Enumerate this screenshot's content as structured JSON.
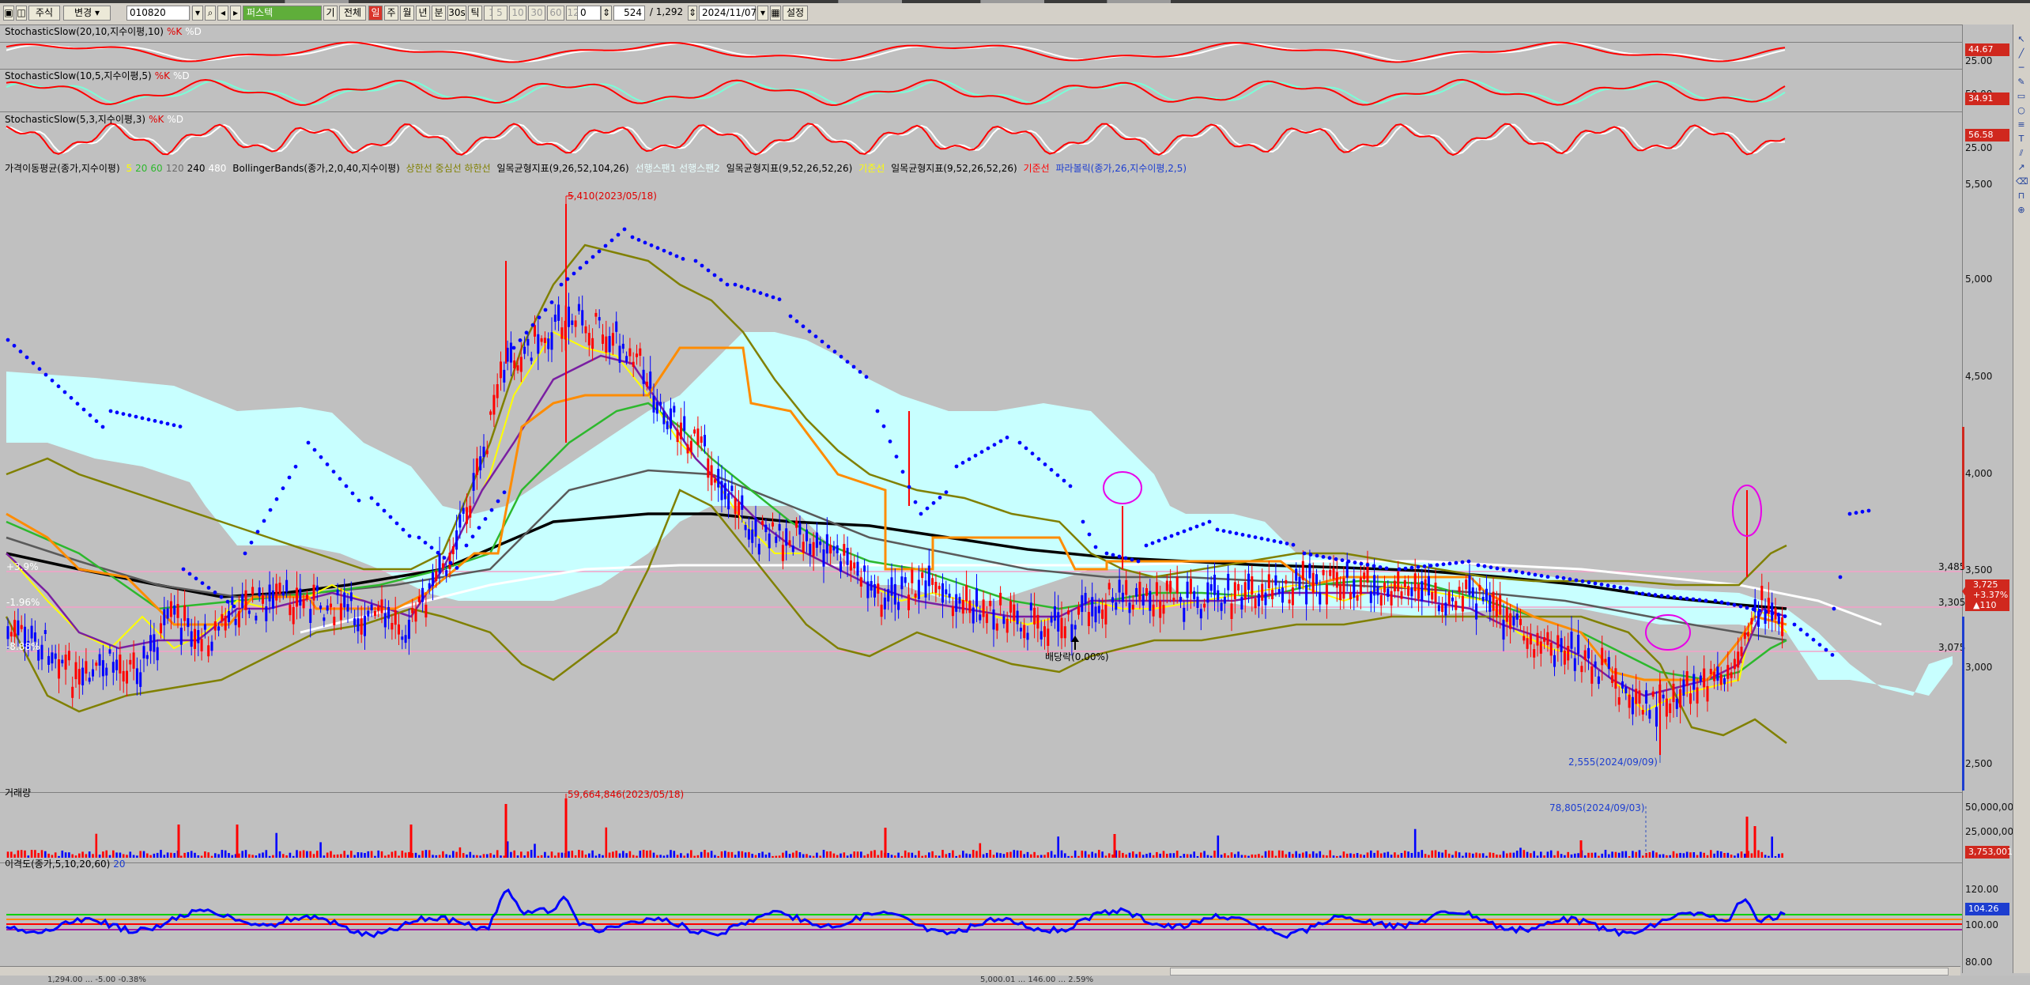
{
  "toolbar": {
    "market_label": "주식",
    "change_label": "변경",
    "code_value": "010820",
    "name_value": "퍼스텍",
    "button_gi": "기",
    "button_all": "전체",
    "button_il": "일",
    "button_ju": "주",
    "button_wol": "월",
    "button_nyeon": "년",
    "button_bun": "분",
    "button_30s": "30s",
    "button_tick": "틱",
    "minute_options": [
      "1",
      "5",
      "10",
      "30",
      "60",
      "120"
    ],
    "count_value": "0",
    "range_value": "524",
    "range_total": "/ 1,292",
    "date_value": "2024/11/07",
    "settings_label": "설정"
  },
  "panels": {
    "stoch1": {
      "label": "StochasticSlow(20,10,지수이평,10)",
      "k_label": "%K",
      "d_label": "%D",
      "axis_value": "25.00",
      "badge": "44.67"
    },
    "stoch2": {
      "label": "StochasticSlow(10,5,지수이평,5)",
      "k_label": "%K",
      "d_label": "%D",
      "axis_value": "50.00",
      "badge": "34.91"
    },
    "stoch3": {
      "label": "StochasticSlow(5,3,지수이평,3)",
      "k_label": "%K",
      "d_label": "%D",
      "axis_value": "25.00",
      "badge": "56.58"
    },
    "price": {
      "ma_label": "가격이동평균(종가,지수이평)",
      "ma_periods": [
        "5",
        "20",
        "60",
        "120",
        "240",
        "480"
      ],
      "bb_label": "BollingerBands(종가,2,0,40,지수이평)",
      "bb_lines": "상한선 중심선 하한선",
      "ichi1_label": "일목균형지표(9,26,52,104,26)",
      "ichi1_lines": "선행스팬1 선행스팬2",
      "ichi2_label": "일목균형지표(9,52,26,52,26)",
      "ichi2_lines": "기준선",
      "ichi3_label": "일목균형지표(9,52,26,52,26)",
      "ichi3_lines": "기준선",
      "sar_label": "파라볼릭(종가,26,지수이평,2,5)",
      "high_annotation": "5,410(2023/05/18)",
      "low_annotation": "2,555(2024/09/09)",
      "event_annotation": "배당락(0.00%)",
      "left_pct_1": "+3.9%",
      "left_pct_2": "-1.96%",
      "left_pct_3": "-8.88%",
      "axis_ticks": [
        "5,500",
        "5,000",
        "4,500",
        "4,000",
        "3,500",
        "3,000",
        "2,500"
      ],
      "level_labels": [
        "3,485",
        "3,305",
        "3,075"
      ],
      "current_price": "3,725",
      "current_change_pct": "+3.37%",
      "current_change": "▲110"
    },
    "volume": {
      "label": "거래량",
      "high_annotation": "59,664,846(2023/05/18)",
      "low_annotation": "78,805(2024/09/03)",
      "axis_ticks": [
        "50,000,000",
        "25,000,000"
      ],
      "badge": "3,753,001"
    },
    "disparity": {
      "label": "이격도(종가,5,10,20,60)",
      "period": "20",
      "axis_ticks": [
        "120.00",
        "100.00",
        "80.00"
      ],
      "badge": "104.26"
    }
  },
  "status": {
    "left_text": "1,294.00 ... -5.00  -0.38%",
    "right_text": "5,000.01 ... 146.00 ... 2.59%"
  },
  "colors": {
    "background": "#c0c0c0",
    "ichimoku_cloud": "#c8ffff",
    "sar_dots": "#0000ff",
    "bollinger": "#808000",
    "kijun": "#ff8c00",
    "up_candle": "#ff0000",
    "down_candle": "#0000ff",
    "stoch_k": "#ff0000",
    "stoch_d": "#ffffff",
    "disparity_line": "#0000ff",
    "highlight_circle": "#e800e8"
  }
}
